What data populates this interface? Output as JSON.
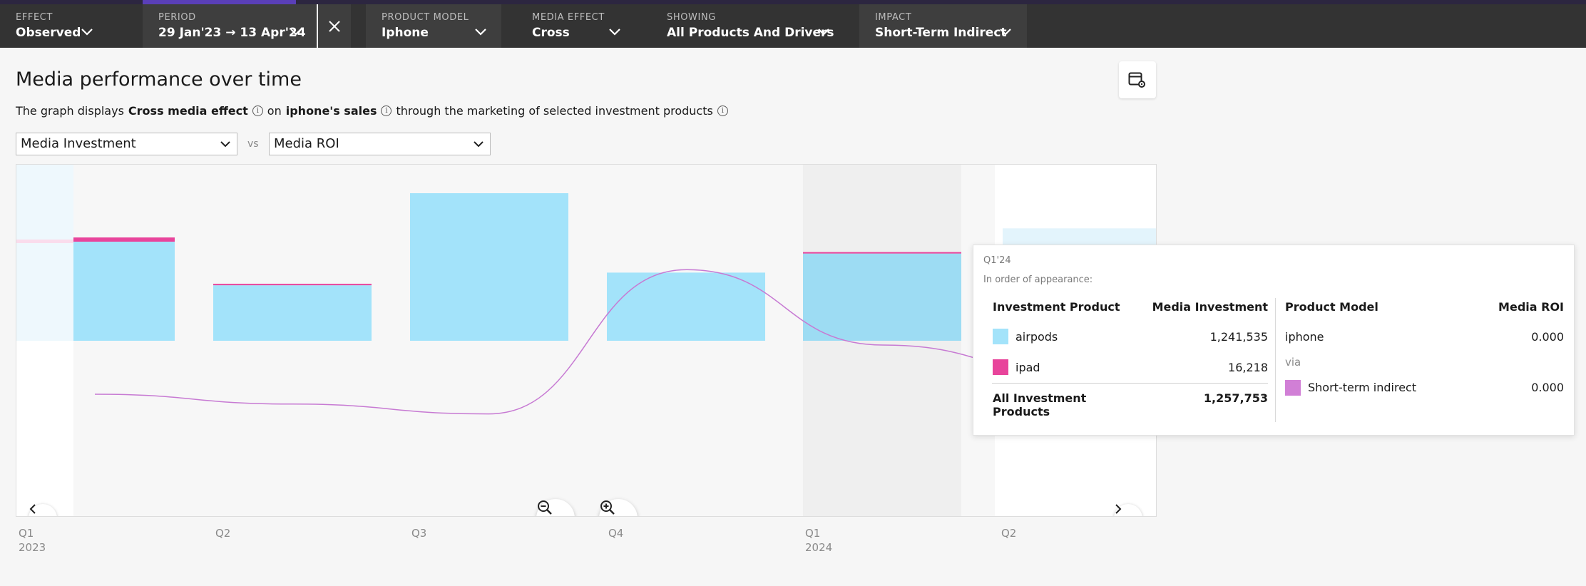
{
  "filters": {
    "effect": {
      "label": "EFFECT",
      "value": "Observed"
    },
    "period": {
      "label": "PERIOD",
      "value": "29 Jan'23 → 13 Apr'24"
    },
    "product_model": {
      "label": "PRODUCT MODEL",
      "value": "Iphone"
    },
    "media_effect": {
      "label": "MEDIA EFFECT",
      "value": "Cross"
    },
    "showing": {
      "label": "SHOWING",
      "value": "All Products And Drivers"
    },
    "impact": {
      "label": "IMPACT",
      "value": "Short-Term Indirect"
    }
  },
  "page": {
    "title": "Media performance over time",
    "description": {
      "prefix": "The graph displays",
      "effect": "Cross media effect",
      "on": "on",
      "sales": "iphone's sales",
      "suffix": "through the marketing of selected investment products"
    }
  },
  "selectors": {
    "left": "Media Investment",
    "vs": "vs",
    "right": "Media ROI"
  },
  "colors": {
    "airpods": "#a3e3fa",
    "ipad": "#e8449b",
    "roi_line": "#c77ad3",
    "short_term_indirect": "#d17fd6"
  },
  "chart_data": {
    "type": "bar",
    "categories": [
      "Q1'23",
      "Q2'23",
      "Q3'23",
      "Q4'23",
      "Q1'24",
      "Q2'24"
    ],
    "series": [
      {
        "name": "airpods",
        "values": [
          1410000,
          790000,
          2100000,
          970000,
          1241535,
          1600000
        ]
      },
      {
        "name": "ipad",
        "values": [
          60000,
          20000,
          0,
          0,
          16218,
          0
        ]
      }
    ],
    "line_series": {
      "values": [
        0.3,
        0.27,
        0.24,
        0.68,
        0.45,
        0.36
      ]
    },
    "x_ticks": [
      {
        "label": "Q1",
        "year": "2023"
      },
      {
        "label": "Q2",
        "year": ""
      },
      {
        "label": "Q3",
        "year": ""
      },
      {
        "label": "Q4",
        "year": ""
      },
      {
        "label": "Q1",
        "year": "2024"
      },
      {
        "label": "Q2",
        "year": ""
      }
    ]
  },
  "tooltip": {
    "period": "Q1'24",
    "order_note": "In order of appearance:",
    "left_header": {
      "col1": "Investment Product",
      "col2": "Media Investment"
    },
    "rows": [
      {
        "name": "airpods",
        "value": "1,241,535"
      },
      {
        "name": "ipad",
        "value": "16,218"
      }
    ],
    "total": {
      "line1": "All Investment",
      "line2": "Products",
      "value": "1,257,753"
    },
    "right_header": {
      "col1": "Product Model",
      "col2": "Media ROI"
    },
    "model": {
      "name": "iphone",
      "value": "0.000"
    },
    "via": "via",
    "driver": {
      "name": "Short-term indirect",
      "value": "0.000"
    }
  }
}
